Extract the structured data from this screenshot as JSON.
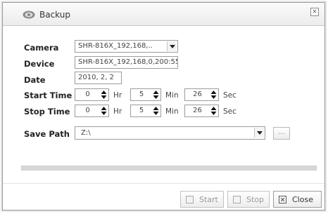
{
  "window": {
    "title": "Backup",
    "close_glyph": "×",
    "icon": "backup-icon"
  },
  "form": {
    "camera_label": "Camera",
    "camera_value": "SHR-816X_192,168,..",
    "device_label": "Device",
    "device_value": "SHR-816X_192,168,0,200:55",
    "date_label": "Date",
    "date_value": "2010, 2, 2",
    "start_time_label": "Start Time",
    "start_time": {
      "hr": "0",
      "min": "5",
      "sec": "26"
    },
    "stop_time_label": "Stop Time",
    "stop_time": {
      "hr": "0",
      "min": "5",
      "sec": "26"
    },
    "units": {
      "hr": "Hr",
      "min": "Min",
      "sec": "Sec"
    },
    "save_path_label": "Save Path",
    "save_path_value": "Z:\\",
    "browse_label": "..."
  },
  "progress": {
    "value": 0
  },
  "buttons": {
    "start": "Start",
    "stop": "Stop",
    "close": "Close"
  },
  "colors": {
    "progress_fill": "#6b9bd1",
    "frame_border": "#9a9a9a"
  }
}
